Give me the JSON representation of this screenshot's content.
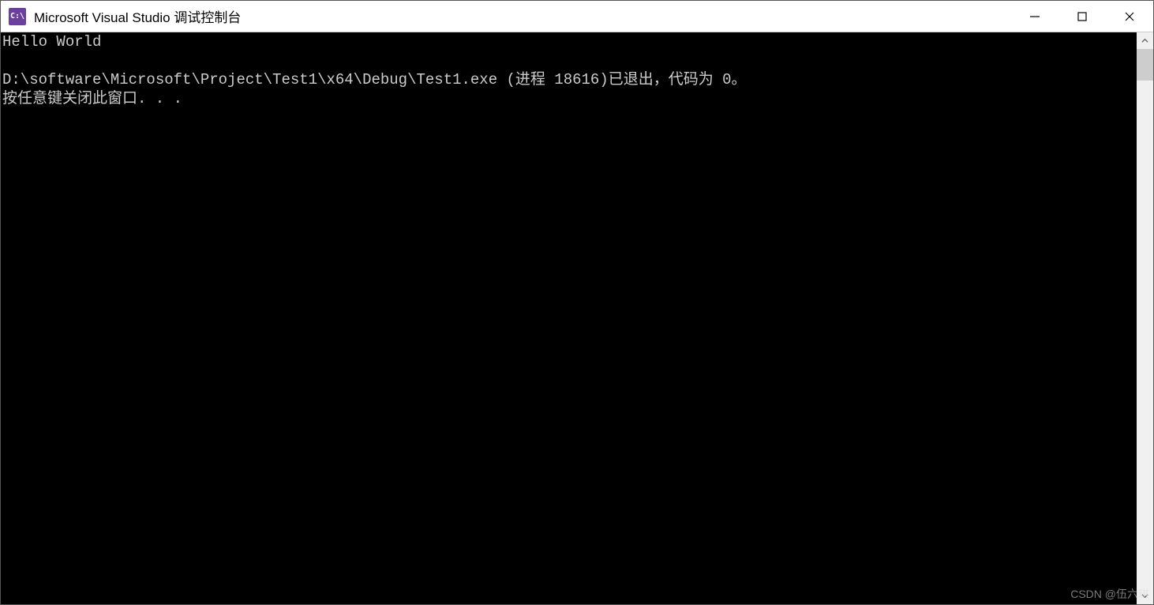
{
  "window": {
    "icon_label": "C:\\",
    "title": "Microsoft Visual Studio 调试控制台"
  },
  "console": {
    "lines": [
      "Hello World",
      "",
      "D:\\software\\Microsoft\\Project\\Test1\\x64\\Debug\\Test1.exe (进程 18616)已退出，代码为 0。",
      "按任意键关闭此窗口. . ."
    ]
  },
  "watermark": "CSDN @伍六琪"
}
